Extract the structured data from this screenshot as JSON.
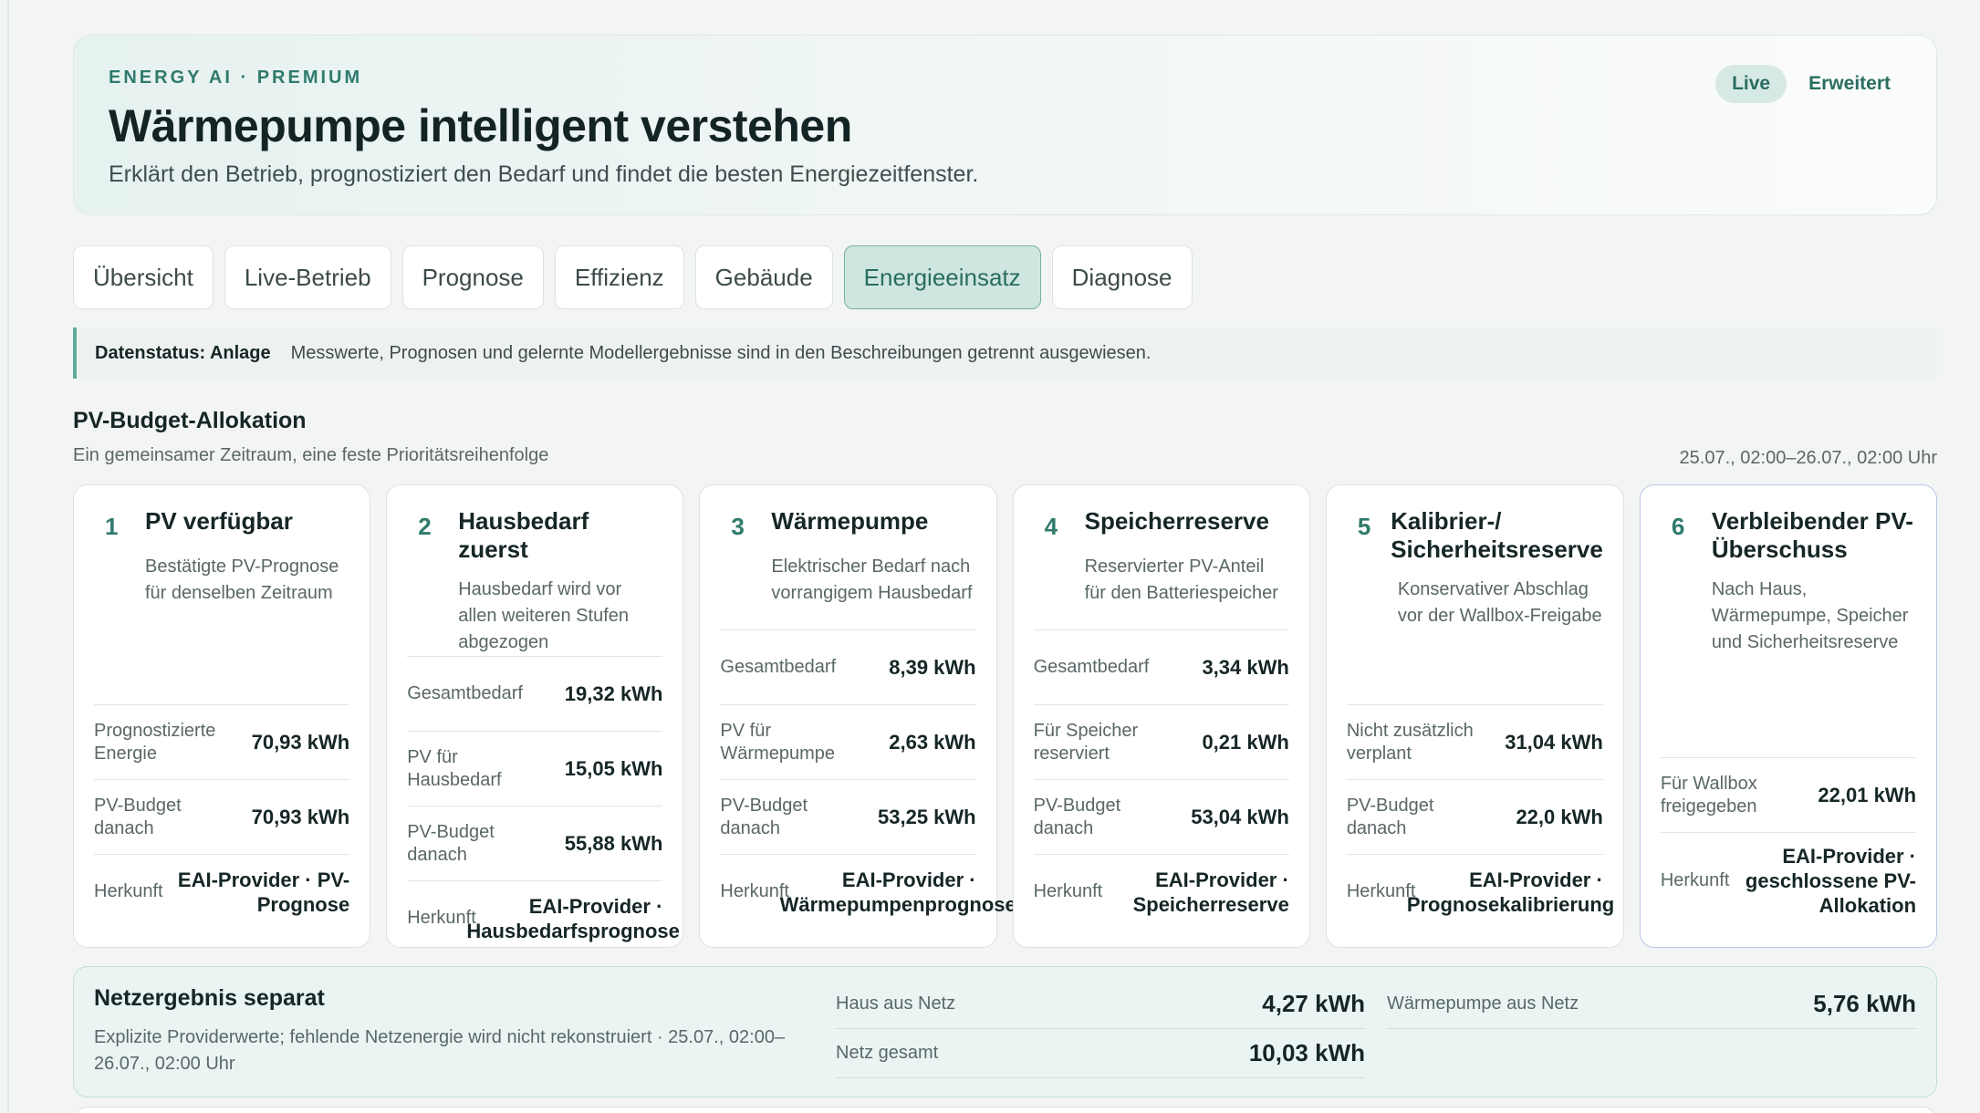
{
  "hero": {
    "eyebrow": "ENERGY AI · PREMIUM",
    "title": "Wärmepumpe intelligent verstehen",
    "subtitle": "Erklärt den Betrieb, prognostiziert den Bedarf und findet die besten Energiezeitfenster.",
    "live_label": "Live",
    "extended_label": "Erweitert"
  },
  "tabs": [
    {
      "label": "Übersicht",
      "active": false
    },
    {
      "label": "Live-Betrieb",
      "active": false
    },
    {
      "label": "Prognose",
      "active": false
    },
    {
      "label": "Effizienz",
      "active": false
    },
    {
      "label": "Gebäude",
      "active": false
    },
    {
      "label": "Energieeinsatz",
      "active": true
    },
    {
      "label": "Diagnose",
      "active": false
    }
  ],
  "status": {
    "label": "Datenstatus: Anlage",
    "text": "Messwerte, Prognosen und gelernte Modellergebnisse sind in den Beschreibungen getrennt ausgewiesen."
  },
  "section": {
    "title": "PV-Budget-Allokation",
    "subtitle": "Ein gemeinsamer Zeitraum, eine feste Prioritätsreihenfolge",
    "range": "25.07., 02:00–26.07., 02:00 Uhr"
  },
  "cards": [
    {
      "num": "1",
      "title": "PV verfügbar",
      "desc": "Bestätigte PV-Prognose für denselben Zeitraum",
      "rows": [
        {
          "label": "Prognostizierte Energie",
          "value": "70,93 kWh"
        },
        {
          "label": "PV-Budget danach",
          "value": "70,93 kWh"
        }
      ],
      "source": {
        "label": "Herkunft",
        "value": "EAI-Provider · PV-Prognose"
      }
    },
    {
      "num": "2",
      "title": "Hausbedarf zuerst",
      "desc": "Hausbedarf wird vor allen weiteren Stufen abgezogen",
      "rows": [
        {
          "label": "Gesamtbedarf",
          "value": "19,32 kWh"
        },
        {
          "label": "PV für Hausbedarf",
          "value": "15,05 kWh"
        },
        {
          "label": "PV-Budget danach",
          "value": "55,88 kWh"
        }
      ],
      "source": {
        "label": "Herkunft",
        "value": "EAI-Provider · Hausbedarfsprognose"
      }
    },
    {
      "num": "3",
      "title": "Wärmepumpe",
      "desc": "Elektrischer Bedarf nach vorrangigem Hausbedarf",
      "rows": [
        {
          "label": "Gesamtbedarf",
          "value": "8,39 kWh"
        },
        {
          "label": "PV für Wärmepumpe",
          "value": "2,63 kWh"
        },
        {
          "label": "PV-Budget danach",
          "value": "53,25 kWh"
        }
      ],
      "source": {
        "label": "Herkunft",
        "value": "EAI-Provider · Wärmepumpenprognose"
      }
    },
    {
      "num": "4",
      "title": "Speicherreserve",
      "desc": "Reservierter PV-Anteil für den Batteriespeicher",
      "rows": [
        {
          "label": "Gesamtbedarf",
          "value": "3,34 kWh"
        },
        {
          "label": "Für Speicher reserviert",
          "value": "0,21 kWh"
        },
        {
          "label": "PV-Budget danach",
          "value": "53,04 kWh"
        }
      ],
      "source": {
        "label": "Herkunft",
        "value": "EAI-Provider · Speicherreserve"
      }
    },
    {
      "num": "5",
      "title": "Kalibrier-/ Sicherheitsreserve",
      "desc": "Konservativer Abschlag vor der Wallbox-Freigabe",
      "rows": [
        {
          "label": "Nicht zusätzlich verplant",
          "value": "31,04 kWh"
        },
        {
          "label": "PV-Budget danach",
          "value": "22,0 kWh"
        }
      ],
      "source": {
        "label": "Herkunft",
        "value": "EAI-Provider · Prognosekalibrierung"
      }
    },
    {
      "num": "6",
      "title": "Verbleibender PV-Überschuss",
      "desc": "Nach Haus, Wärmepumpe, Speicher und Sicherheitsreserve",
      "rows": [
        {
          "label": "Für Wallbox freigegeben",
          "value": "22,01 kWh"
        }
      ],
      "source": {
        "label": "Herkunft",
        "value": "EAI-Provider · geschlossene PV-Allokation"
      }
    }
  ],
  "grid": {
    "title": "Netzergebnis separat",
    "note": "Explizite Providerwerte; fehlende Netzenergie wird nicht rekonstruiert · 25.07., 02:00–26.07., 02:00 Uhr",
    "house_label": "Haus aus Netz",
    "house_value": "4,27 kWh",
    "hp_label": "Wärmepumpe aus Netz",
    "hp_value": "5,76 kWh",
    "total_label": "Netz gesamt",
    "total_value": "10,03 kWh"
  }
}
